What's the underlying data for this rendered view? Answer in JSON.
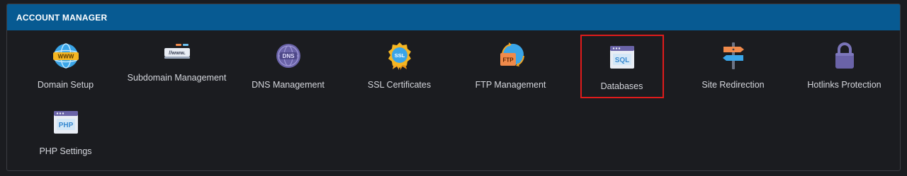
{
  "panel": {
    "title": "ACCOUNT MANAGER"
  },
  "tiles": [
    {
      "label": "Domain Setup",
      "icon": "globe-www-icon"
    },
    {
      "label": "Subdomain Management",
      "icon": "subdomain-url-icon"
    },
    {
      "label": "DNS Management",
      "icon": "dns-globe-icon"
    },
    {
      "label": "SSL Certificates",
      "icon": "ssl-badge-icon"
    },
    {
      "label": "FTP Management",
      "icon": "ftp-sync-icon"
    },
    {
      "label": "Databases",
      "icon": "sql-database-icon"
    },
    {
      "label": "Site Redirection",
      "icon": "signpost-icon"
    },
    {
      "label": "Hotlinks Protection",
      "icon": "padlock-icon"
    },
    {
      "label": "PHP Settings",
      "icon": "php-window-icon"
    }
  ],
  "icon_text": {
    "www": "WWW",
    "url": "//www.",
    "dns": "DNS",
    "ssl": "SSL",
    "ftp": "FTP",
    "sql": "SQL",
    "php": "PHP"
  },
  "colors": {
    "header": "#075a92",
    "background": "#1b1c20",
    "highlight": "#e01b1b"
  }
}
